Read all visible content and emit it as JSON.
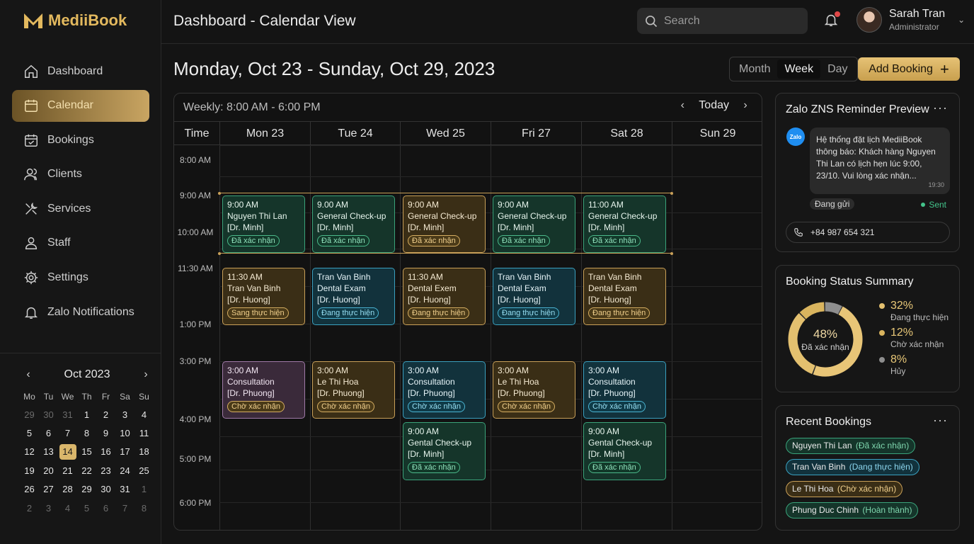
{
  "app": {
    "name": "MediiBook"
  },
  "header": {
    "title": "Dashboard - Calendar View",
    "search_placeholder": "Search",
    "user_name": "Sarah Tran",
    "user_role": "Administrator"
  },
  "sidebar": {
    "items": [
      {
        "label": "Dashboard",
        "icon": "home-icon"
      },
      {
        "label": "Calendar",
        "icon": "calendar-icon",
        "active": true
      },
      {
        "label": "Bookings",
        "icon": "calendar-check-icon"
      },
      {
        "label": "Clients",
        "icon": "users-icon"
      },
      {
        "label": "Services",
        "icon": "tools-icon"
      },
      {
        "label": "Staff",
        "icon": "user-icon"
      },
      {
        "label": "Settings",
        "icon": "gear-icon"
      },
      {
        "label": "Zalo Notifications",
        "icon": "bell-icon"
      }
    ]
  },
  "mini_calendar": {
    "title": "Oct 2023",
    "prev": "‹",
    "next": "›",
    "weekdays": [
      "Mo",
      "Tu",
      "We",
      "Th",
      "Fr",
      "Sa",
      "Su"
    ],
    "days": [
      {
        "d": "29",
        "dim": true
      },
      {
        "d": "30",
        "dim": true
      },
      {
        "d": "31",
        "dim": true
      },
      {
        "d": "1"
      },
      {
        "d": "2"
      },
      {
        "d": "3"
      },
      {
        "d": "4"
      },
      {
        "d": "5"
      },
      {
        "d": "6"
      },
      {
        "d": "7"
      },
      {
        "d": "8"
      },
      {
        "d": "9"
      },
      {
        "d": "10"
      },
      {
        "d": "11"
      },
      {
        "d": "12"
      },
      {
        "d": "13"
      },
      {
        "d": "14",
        "today": true
      },
      {
        "d": "15"
      },
      {
        "d": "16"
      },
      {
        "d": "17"
      },
      {
        "d": "18"
      },
      {
        "d": "19"
      },
      {
        "d": "20"
      },
      {
        "d": "21"
      },
      {
        "d": "22"
      },
      {
        "d": "23"
      },
      {
        "d": "24"
      },
      {
        "d": "25"
      },
      {
        "d": "26"
      },
      {
        "d": "27"
      },
      {
        "d": "28"
      },
      {
        "d": "29"
      },
      {
        "d": "30"
      },
      {
        "d": "31"
      },
      {
        "d": "1",
        "dim": true
      },
      {
        "d": "2",
        "dim": true
      },
      {
        "d": "3",
        "dim": true
      },
      {
        "d": "4",
        "dim": true
      },
      {
        "d": "5",
        "dim": true
      },
      {
        "d": "6",
        "dim": true
      },
      {
        "d": "7",
        "dim": true
      },
      {
        "d": "8",
        "dim": true
      }
    ]
  },
  "main": {
    "range_title": "Monday, Oct 23 - Sunday, Oct 29, 2023",
    "views": [
      {
        "label": "Month"
      },
      {
        "label": "Week",
        "active": true
      },
      {
        "label": "Day"
      }
    ],
    "add_button": "Add Booking",
    "add_button_icon": "+"
  },
  "calendar": {
    "range_label": "Weekly: 8:00 AM - 6:00 PM",
    "prev": "‹",
    "next": "›",
    "today_label": "Today",
    "columns": [
      "Time",
      "Mon 23",
      "Tue 24",
      "Wed 25",
      "Fri 27",
      "Sat 28",
      "Sun 29"
    ],
    "time_labels": [
      "8:00 AM",
      "9:00 AM",
      "10:00 AM",
      "11:30 AM",
      "1:00 PM",
      "3:00 PM",
      "4:00 PM",
      "5:00 PM",
      "6:00 PM"
    ],
    "events": [
      {
        "col": 0,
        "row": 0,
        "color": "green",
        "lines": [
          "9:00 AM",
          "Nguyen Thi Lan",
          "[Dr. Minh]"
        ],
        "badge": "Đã xác nhận"
      },
      {
        "col": 1,
        "row": 0,
        "color": "green",
        "lines": [
          "9.00 AM",
          "General Check-up",
          "[Dr. Minh]"
        ],
        "badge": "Đã xác nhận"
      },
      {
        "col": 2,
        "row": 0,
        "color": "gold",
        "lines": [
          "9:00 AM",
          "General Check-up",
          "[Dr. Minh]"
        ],
        "badge": "Đã xác nhận"
      },
      {
        "col": 3,
        "row": 0,
        "color": "green",
        "lines": [
          "9:00 AM",
          "General Check-up",
          "[Dr. Minh]"
        ],
        "badge": "Đã xác nhận"
      },
      {
        "col": 4,
        "row": 0,
        "color": "green",
        "lines": [
          "11:00 AM",
          "General Check-up",
          "[Dr. Minh]"
        ],
        "badge": "Đã xác nhận"
      },
      {
        "col": 0,
        "row": 1,
        "color": "gold",
        "lines": [
          "11:30 AM",
          "Tran Van Binh",
          "[Dr. Huong]"
        ],
        "badge": "Sang thực hiện"
      },
      {
        "col": 1,
        "row": 1,
        "color": "blue",
        "lines": [
          "Tran Van Binh",
          "Dental Exam",
          "[Dr. Huong]"
        ],
        "badge": "Đang thực hiện"
      },
      {
        "col": 2,
        "row": 1,
        "color": "gold",
        "lines": [
          "11:30 AM",
          "Dental Exem",
          "[Dr. Huong]"
        ],
        "badge": "Đang thực hiện"
      },
      {
        "col": 3,
        "row": 1,
        "color": "blue",
        "lines": [
          "Tran Van Binh",
          "Dental Exam",
          "[Dr. Huong]"
        ],
        "badge": "Đang thực hiện"
      },
      {
        "col": 4,
        "row": 1,
        "color": "gold",
        "lines": [
          "Tran Van Binh",
          "Dental Exam",
          "[Dr. Huong]"
        ],
        "badge": "Đang thực hiện"
      },
      {
        "col": 0,
        "row": 2,
        "color": "purple",
        "lines": [
          "3:00 AM",
          "Consultation",
          "[Dr. Phuong]"
        ],
        "badge": "Chờ xác nhận"
      },
      {
        "col": 1,
        "row": 2,
        "color": "gold",
        "lines": [
          "3:00 AM",
          "Le Thi Hoa",
          "[Dr. Phuong]"
        ],
        "badge": "Chờ xác nhận"
      },
      {
        "col": 2,
        "row": 2,
        "color": "blue",
        "lines": [
          "3:00 AM",
          "Consultation",
          "[Dr. Phuong]"
        ],
        "badge": "Chờ xác nhận"
      },
      {
        "col": 3,
        "row": 2,
        "color": "gold",
        "lines": [
          "3:00 AM",
          "Le Thi Hoa",
          "[Dr. Phuong]"
        ],
        "badge": "Chờ xác nhận"
      },
      {
        "col": 4,
        "row": 2,
        "color": "blue",
        "lines": [
          "3:00 AM",
          "Consultation",
          "[Dr. Phuong]"
        ],
        "badge": "Chờ xác nhận"
      },
      {
        "col": 2,
        "row": 3,
        "color": "green",
        "lines": [
          "9:00 AM",
          "Gental Check-up",
          "[Dr. Minh]"
        ],
        "badge": "Đã xác nhận"
      },
      {
        "col": 4,
        "row": 3,
        "color": "green",
        "lines": [
          "9:00 AM",
          "Gental Check-up",
          "[Dr. Minh]"
        ],
        "badge": "Đã xác nhận"
      }
    ]
  },
  "zalo_card": {
    "title": "Zalo ZNS Reminder Preview",
    "more": "···",
    "logo": "Zalo",
    "message": "Hệ thống đặt lịch MediiBook thông báo: Khách hàng Nguyen Thi Lan có lịch hẹn lúc 9:00, 23/10. Vui lòng xác nhận...",
    "time": "19:30",
    "status": "Đang gửi",
    "sent": "Sent",
    "phone": "+84 987 654 321"
  },
  "status_card": {
    "title": "Booking Status Summary",
    "center_pct": "48%",
    "center_label": "Đã xác nhận",
    "items": [
      {
        "pct": "32%",
        "label": "Đang thực hiện",
        "color": "#e3c06f"
      },
      {
        "pct": "12%",
        "label": "Chờ xác nhận",
        "color": "#d9b45e"
      },
      {
        "pct": "8%",
        "label": "Hủy",
        "color": "#8e8e8e"
      }
    ]
  },
  "recent_card": {
    "title": "Recent Bookings",
    "more": "···",
    "items": [
      {
        "name": "Nguyen Thi Lan",
        "status": "(Đã xác nhận)",
        "color": "green"
      },
      {
        "name": "Tran Van Binh",
        "status": "(Dang thực hiện)",
        "color": "blue"
      },
      {
        "name": "Le Thi Hoa",
        "status": "(Chờ xác nhận)",
        "color": "gold"
      },
      {
        "name": "Phung Duc Chinh",
        "status": "(Hoàn thành)",
        "color": "green"
      }
    ]
  }
}
